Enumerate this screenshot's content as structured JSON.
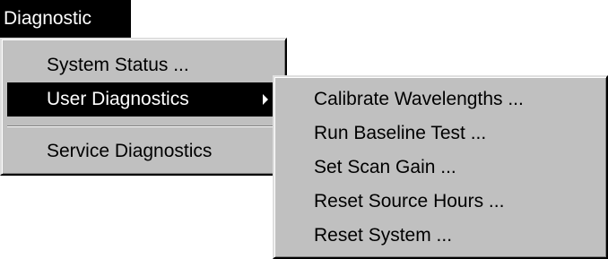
{
  "menubar": {
    "title": "Diagnostic"
  },
  "main_menu": {
    "items": [
      {
        "label": "System Status ..."
      },
      {
        "label": "User Diagnostics",
        "selected": true,
        "has_submenu": true
      },
      {
        "label": "Service Diagnostics"
      }
    ]
  },
  "sub_menu": {
    "items": [
      {
        "label": "Calibrate Wavelengths ..."
      },
      {
        "label": "Run Baseline Test ..."
      },
      {
        "label": "Set Scan Gain ..."
      },
      {
        "label": "Reset Source Hours ..."
      },
      {
        "label": "Reset System ..."
      }
    ]
  },
  "colors": {
    "menu_background": "#c0c0c0",
    "highlight": "#000000",
    "highlight_text": "#ffffff"
  },
  "icons": {
    "submenu_arrow": "triangle-right-icon"
  }
}
